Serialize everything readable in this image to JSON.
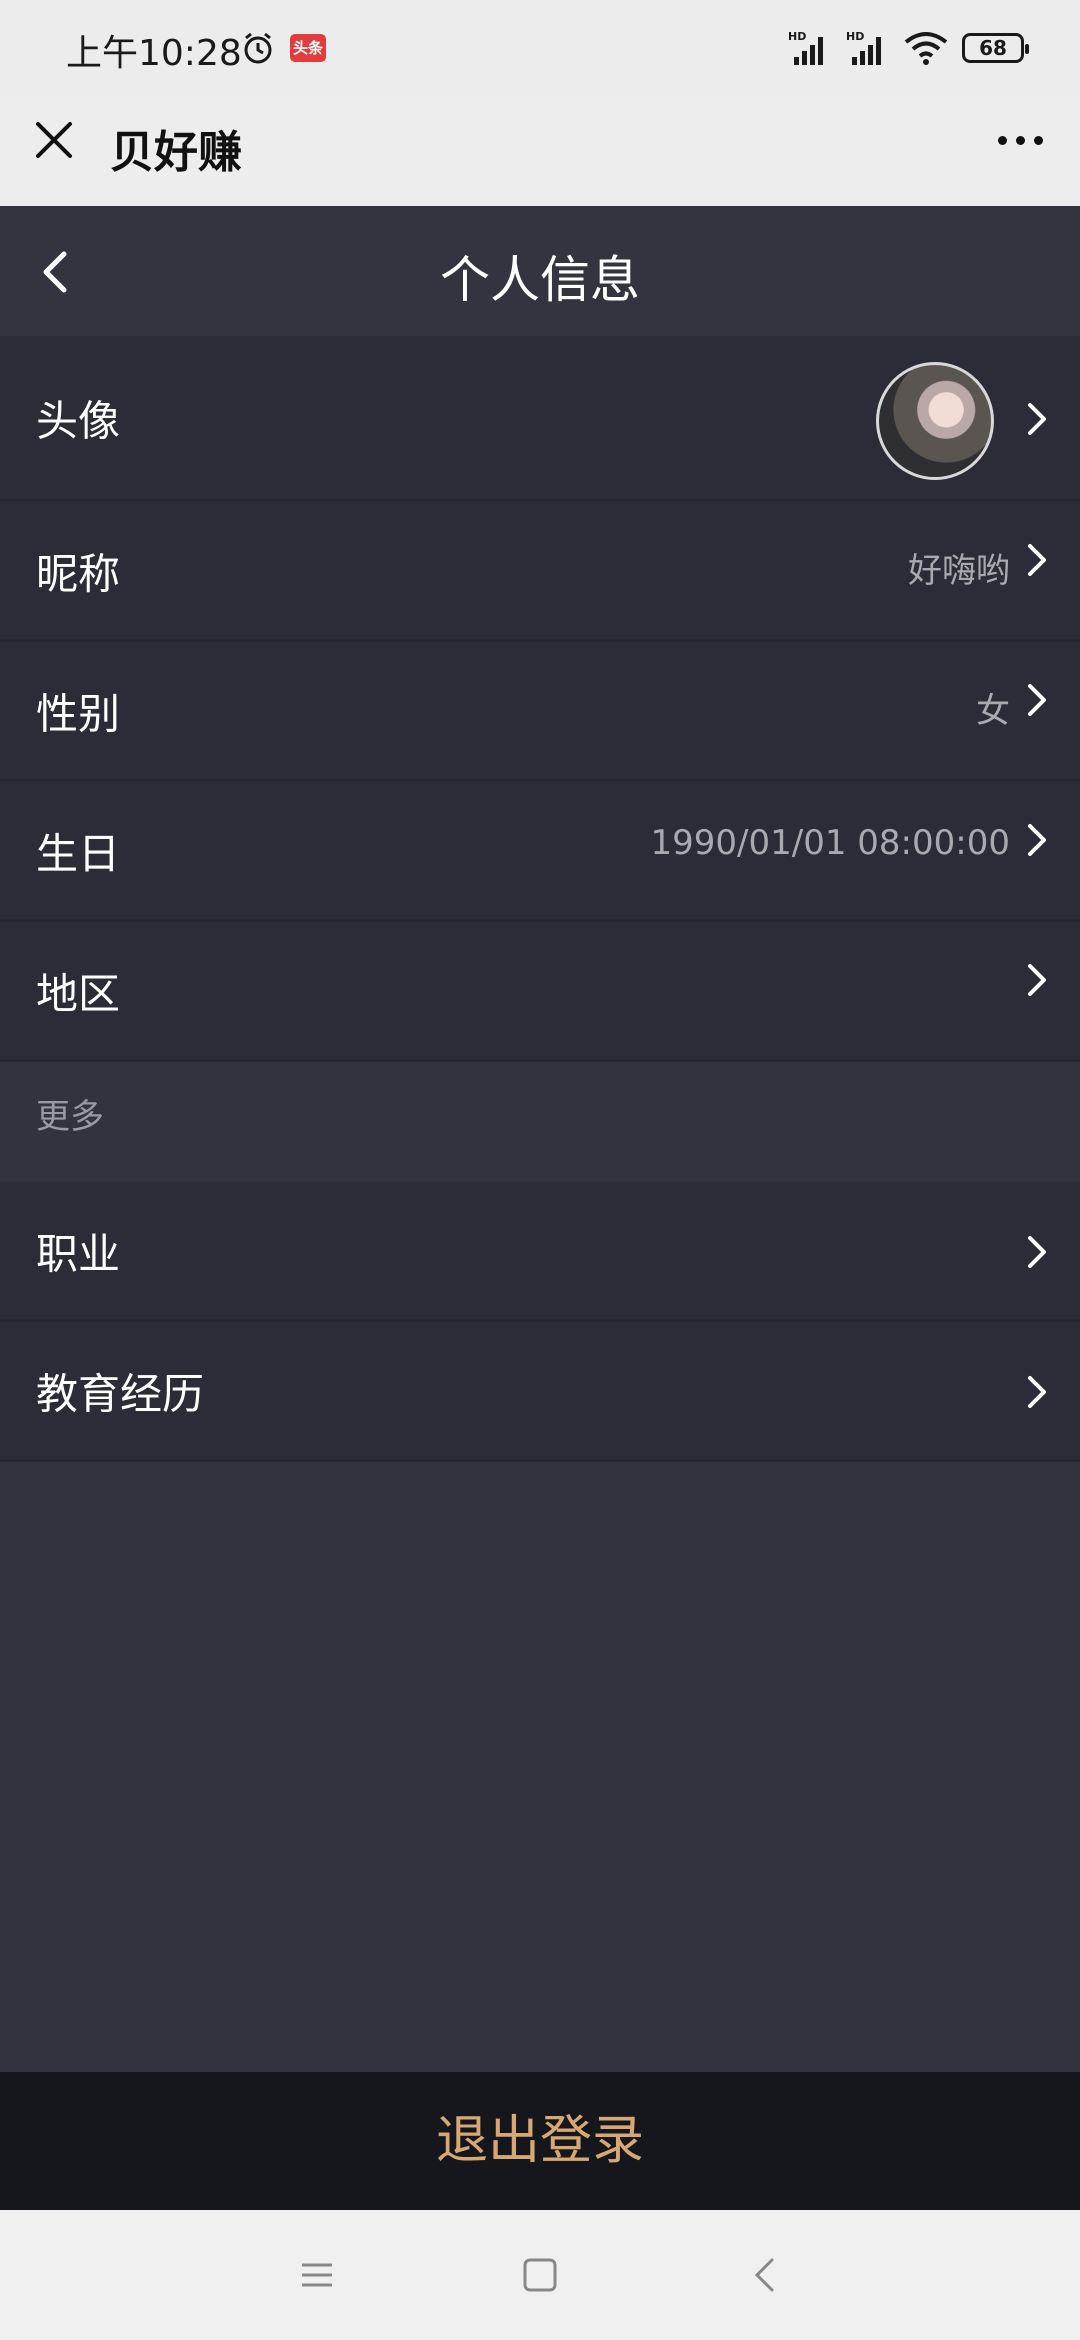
{
  "status_bar": {
    "time": "上午10:28",
    "app_badge": "头条",
    "battery": "68",
    "signal_1": "HD",
    "signal_2": "HD"
  },
  "app_bar": {
    "title": "贝好赚"
  },
  "header": {
    "title": "个人信息"
  },
  "rows": [
    {
      "label": "头像",
      "value": ""
    },
    {
      "label": "昵称",
      "value": "好嗨哟"
    },
    {
      "label": "性别",
      "value": "女"
    },
    {
      "label": "生日",
      "value": "1990/01/01 08:00:00"
    },
    {
      "label": "地区",
      "value": ""
    }
  ],
  "section_more": {
    "label": "更多"
  },
  "more_rows": [
    {
      "label": "职业"
    },
    {
      "label": "教育经历"
    }
  ],
  "logout": {
    "label": "退出登录"
  },
  "colors": {
    "background": "#32333f",
    "row_bg": "#2b2c37",
    "logout_text": "#d6a874",
    "logout_bg": "#16171c"
  }
}
